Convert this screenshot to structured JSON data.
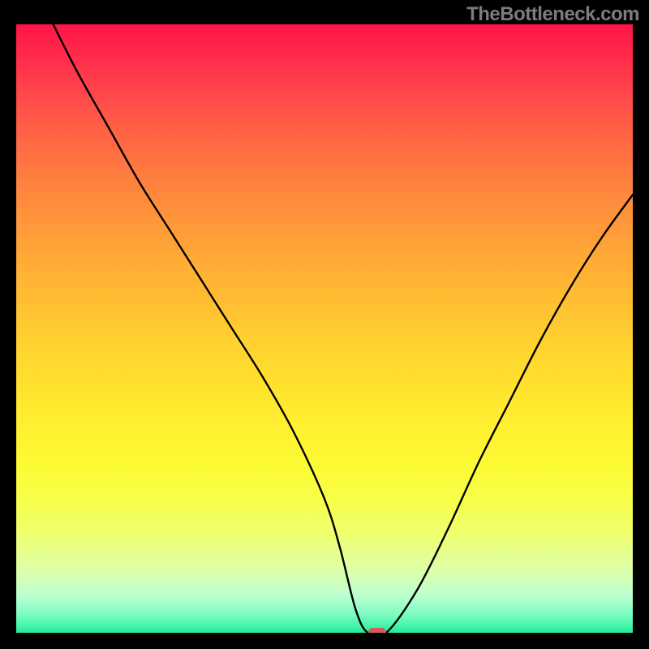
{
  "watermark": "TheBottleneck.com",
  "chart_data": {
    "type": "line",
    "title": "",
    "xlabel": "",
    "ylabel": "",
    "xlim": [
      0,
      100
    ],
    "ylim": [
      0,
      100
    ],
    "grid": false,
    "series": [
      {
        "name": "curve",
        "x": [
          6,
          10,
          15,
          20,
          25,
          30,
          35,
          40,
          45,
          50,
          52.5,
          55,
          57,
          60,
          65,
          70,
          75,
          80,
          85,
          90,
          95,
          100
        ],
        "values": [
          100,
          92,
          83,
          74,
          66,
          58,
          50,
          42,
          33,
          22,
          14,
          4,
          0,
          0,
          7,
          17,
          28,
          38,
          48,
          57,
          65,
          72
        ]
      }
    ],
    "marker": {
      "x": 58.5,
      "y": 0
    },
    "gradient_colors": {
      "top": "#ff1547",
      "mid": "#ffe32e",
      "bottom": "#27e79a"
    }
  }
}
